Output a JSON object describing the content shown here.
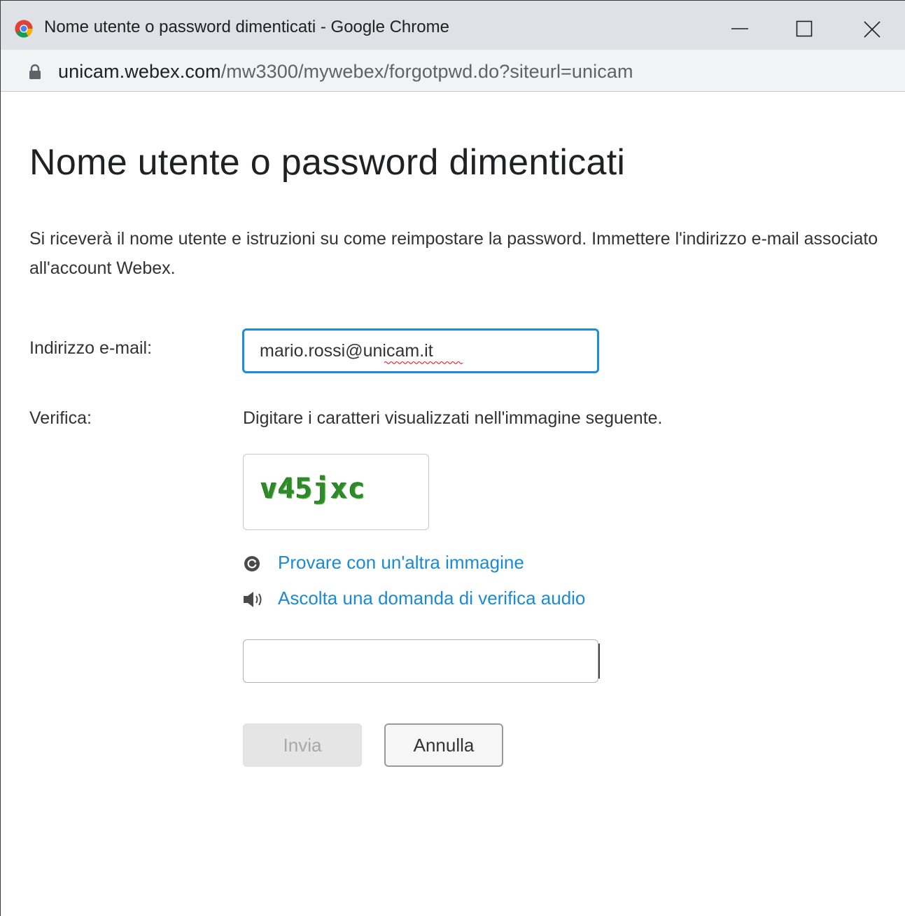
{
  "window": {
    "title": "Nome utente o password dimenticati - Google Chrome",
    "controls": [
      "minimize",
      "maximize",
      "close"
    ]
  },
  "address_bar": {
    "host": "unicam.webex.com",
    "path": "/mw3300/mywebex/forgotpwd.do?siteurl=unicam",
    "security_icon": "lock-icon"
  },
  "page": {
    "title": "Nome utente o password dimenticati",
    "description": "Si riceverà il nome utente e istruzioni su come reimpostare la password. Immettere l'indirizzo e-mail associato all'account Webex.",
    "email": {
      "label": "Indirizzo e-mail:",
      "value": "mario.rossi@unicam.it"
    },
    "verification": {
      "label": "Verifica:",
      "instruction": "Digitare i caratteri visualizzati nell'immagine seguente.",
      "captcha_text": "v45jxc",
      "refresh_link": "Provare con un'altra immagine",
      "audio_link": "Ascolta una domanda di verifica audio",
      "input_value": ""
    },
    "buttons": {
      "submit": "Invia",
      "cancel": "Annulla"
    }
  },
  "colors": {
    "link": "#1b8ad3",
    "focus_border": "#1d8ddb",
    "captcha_green": "#2f8b2a",
    "titlebar_bg": "#dee1e6",
    "addressbar_bg": "#f1f3f4",
    "disabled_button_bg": "#e5e5e5"
  }
}
